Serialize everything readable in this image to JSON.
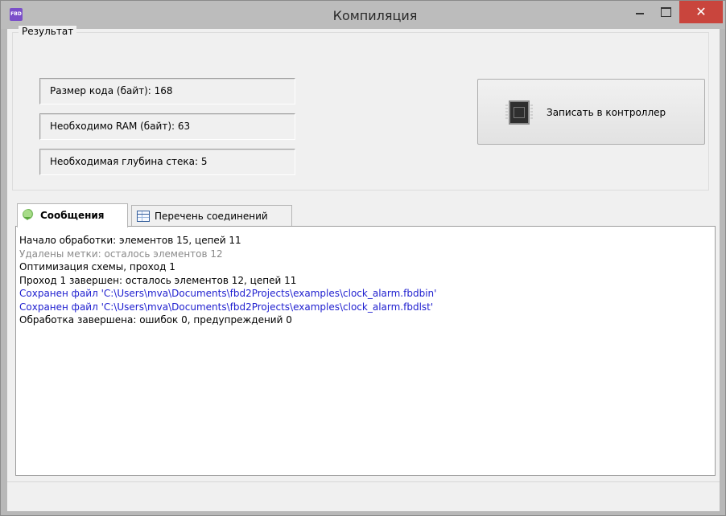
{
  "window": {
    "title": "Компиляция",
    "app_icon_text": "FBD",
    "close_glyph": "✕"
  },
  "result": {
    "group_label": "Результат",
    "code_size": "Размер кода (байт): 168",
    "ram_needed": "Необходимо RAM (байт): 63",
    "stack_depth": "Необходимая глубина стека: 5"
  },
  "write_button": {
    "label": "Записать в контроллер",
    "icon": "chip-icon"
  },
  "tabs": [
    {
      "label": "Сообщения",
      "icon": "speech-bubble-icon",
      "active": true
    },
    {
      "label": "Перечень соединений",
      "icon": "table-icon",
      "active": false
    }
  ],
  "messages": [
    {
      "text": "Начало обработки: элементов 15, цепей 11",
      "color": "#000000"
    },
    {
      "text": "Удалены метки: осталось элементов 12",
      "color": "#8a8a8a"
    },
    {
      "text": "Оптимизация схемы, проход 1",
      "color": "#000000"
    },
    {
      "text": "Проход 1 завершен: осталось элементов 12, цепей 11",
      "color": "#000000"
    },
    {
      "text": "Сохранен файл 'C:\\Users\\mva\\Documents\\fbd2Projects\\examples\\clock_alarm.fbdbin'",
      "color": "#1e1ecf"
    },
    {
      "text": "Сохранен файл 'C:\\Users\\mva\\Documents\\fbd2Projects\\examples\\clock_alarm.fbdlst'",
      "color": "#1e1ecf"
    },
    {
      "text": "Обработка завершена: ошибок 0, предупреждений 0",
      "color": "#000000"
    }
  ],
  "colors": {
    "close_button": "#c9453d",
    "titlebar": "#bcbcbc",
    "info_text": "#1e1ecf",
    "muted_text": "#8a8a8a"
  }
}
